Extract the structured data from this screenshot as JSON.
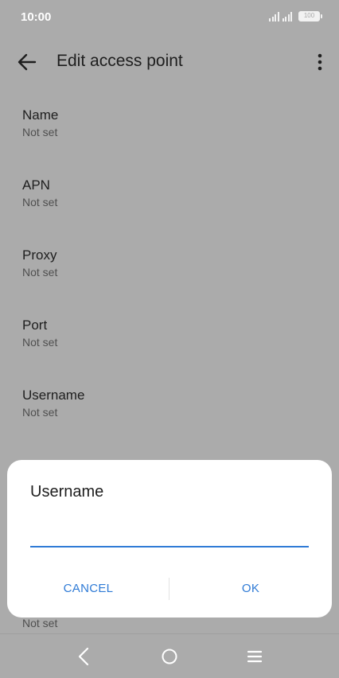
{
  "status_bar": {
    "time": "10:00",
    "battery_level": "100"
  },
  "app_bar": {
    "title": "Edit access point"
  },
  "settings": [
    {
      "title": "Name",
      "summary": "Not set"
    },
    {
      "title": "APN",
      "summary": "Not set"
    },
    {
      "title": "Proxy",
      "summary": "Not set"
    },
    {
      "title": "Port",
      "summary": "Not set"
    },
    {
      "title": "Username",
      "summary": "Not set"
    }
  ],
  "obscured_item": {
    "summary": "Not set"
  },
  "dialog": {
    "title": "Username",
    "input_value": "",
    "cancel_label": "CANCEL",
    "ok_label": "OK"
  },
  "colors": {
    "accent": "#2f7bd6",
    "scrim_background": "#ababab",
    "dialog_background": "#ffffff"
  },
  "icons": {
    "back": "back-arrow-icon",
    "more": "more-vert-icon",
    "nav_back": "nav-back-icon",
    "nav_home": "nav-home-icon",
    "nav_menu": "nav-menu-icon"
  }
}
